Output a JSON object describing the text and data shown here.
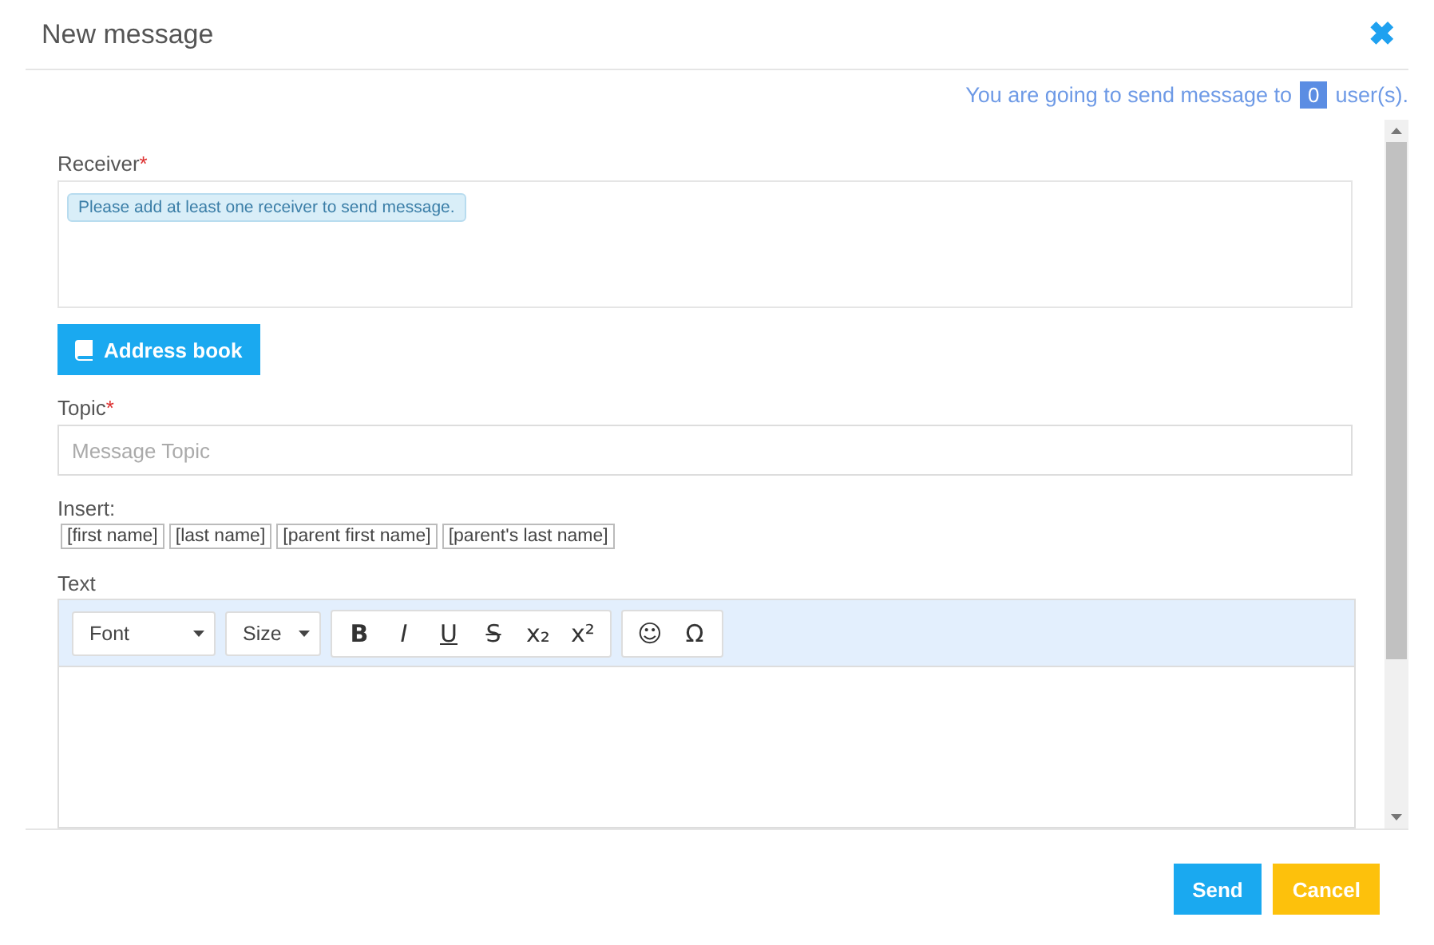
{
  "dialog": {
    "title": "New message",
    "close": "✖"
  },
  "recipient_notice": {
    "prefix": "You are going to send message to",
    "count": "0",
    "suffix": "user(s)."
  },
  "receiver": {
    "label": "Receiver",
    "required": "*",
    "hint": "Please add at least one receiver to send message."
  },
  "address_book_button": "Address book",
  "topic": {
    "label": "Topic",
    "required": "*",
    "placeholder": "Message Topic"
  },
  "insert": {
    "label": "Insert:",
    "tokens": [
      "[first name]",
      "[last name]",
      "[parent first name]",
      "[parent's last name]"
    ]
  },
  "text_editor": {
    "label": "Text",
    "dropdowns": [
      {
        "label": "Font"
      },
      {
        "label": "Size"
      }
    ],
    "tool_groups": [
      [
        {
          "kind": "bold",
          "glyph": "B"
        },
        {
          "kind": "italic",
          "glyph": "I"
        },
        {
          "kind": "underline",
          "glyph": "U"
        },
        {
          "kind": "strike",
          "glyph": "S"
        },
        {
          "kind": "plain",
          "glyph": "x₂"
        },
        {
          "kind": "plain",
          "glyph": "x²"
        }
      ],
      [
        {
          "kind": "plain",
          "glyph": "☺"
        },
        {
          "kind": "plain",
          "glyph": "Ω"
        }
      ]
    ]
  },
  "buttons": [
    {
      "label": "Send",
      "kind": "primary"
    },
    {
      "label": "Cancel",
      "kind": "warning"
    }
  ]
}
